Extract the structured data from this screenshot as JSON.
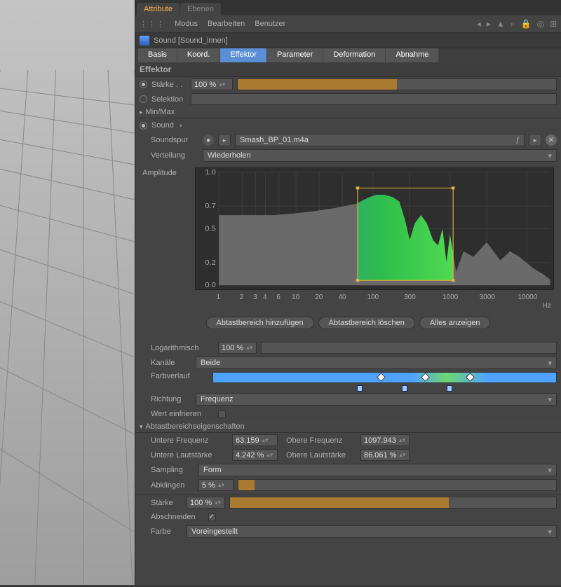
{
  "tabs": {
    "attribute": "Attribute",
    "layers": "Ebenen"
  },
  "toolbar": {
    "mode": "Modus",
    "edit": "Bearbeiten",
    "user": "Benutzer"
  },
  "object": {
    "title": "Sound [Sound_innen]"
  },
  "subtabs": {
    "basis": "Basis",
    "koord": "Koord.",
    "effektor": "Effektor",
    "parameter": "Parameter",
    "deformation": "Deformation",
    "abnahme": "Abnahme"
  },
  "section": {
    "effektor": "Effektor"
  },
  "strength": {
    "label": "Stärke . .",
    "value": "100 %"
  },
  "selection": {
    "label": "Selektion"
  },
  "minmax": {
    "label": "Min/Max"
  },
  "sound": {
    "header": "Sound",
    "track_label": "Soundspur",
    "file": "Smash_BP_01.m4a",
    "distribution_label": "Verteilung",
    "distribution_value": "Wiederholen",
    "amplitude_label": "Amplitude"
  },
  "chart_data": {
    "type": "area",
    "xlabel": "Hz",
    "ylabel": "Amplitude",
    "yticks": [
      0.0,
      0.2,
      0.5,
      0.7,
      1.0
    ],
    "xticks": [
      1,
      2,
      3,
      4,
      6,
      10,
      20,
      40,
      100,
      300,
      1000,
      3000,
      10000
    ],
    "xscale": "log",
    "ylim": [
      0.0,
      1.0
    ],
    "xlim": [
      1,
      20000
    ],
    "selection_box": {
      "xmin": 63.159,
      "xmax": 1097.943,
      "ymin": 0.04242,
      "ymax": 0.86061
    },
    "spectrum": [
      {
        "x": 1,
        "y": 0.62
      },
      {
        "x": 2,
        "y": 0.62
      },
      {
        "x": 3,
        "y": 0.62
      },
      {
        "x": 5,
        "y": 0.62
      },
      {
        "x": 8,
        "y": 0.63
      },
      {
        "x": 15,
        "y": 0.65
      },
      {
        "x": 30,
        "y": 0.68
      },
      {
        "x": 60,
        "y": 0.72
      },
      {
        "x": 90,
        "y": 0.78
      },
      {
        "x": 110,
        "y": 0.8
      },
      {
        "x": 140,
        "y": 0.8
      },
      {
        "x": 180,
        "y": 0.78
      },
      {
        "x": 220,
        "y": 0.74
      },
      {
        "x": 260,
        "y": 0.58
      },
      {
        "x": 300,
        "y": 0.4
      },
      {
        "x": 350,
        "y": 0.55
      },
      {
        "x": 420,
        "y": 0.62
      },
      {
        "x": 500,
        "y": 0.55
      },
      {
        "x": 600,
        "y": 0.4
      },
      {
        "x": 700,
        "y": 0.35
      },
      {
        "x": 800,
        "y": 0.5
      },
      {
        "x": 900,
        "y": 0.2
      },
      {
        "x": 1000,
        "y": 0.45
      },
      {
        "x": 1200,
        "y": 0.12
      },
      {
        "x": 1500,
        "y": 0.3
      },
      {
        "x": 2000,
        "y": 0.25
      },
      {
        "x": 3000,
        "y": 0.38
      },
      {
        "x": 4500,
        "y": 0.22
      },
      {
        "x": 6000,
        "y": 0.3
      },
      {
        "x": 8000,
        "y": 0.25
      },
      {
        "x": 12000,
        "y": 0.15
      },
      {
        "x": 16000,
        "y": 0.1
      },
      {
        "x": 20000,
        "y": 0.05
      }
    ]
  },
  "buttons": {
    "add_range": "Abtastbereich hinzufügen",
    "del_range": "Abtastbereich löschen",
    "show_all": "Alles anzeigen"
  },
  "log": {
    "label": "Logarithmisch",
    "value": "100 %"
  },
  "channels": {
    "label": "Kanäle",
    "value": "Beide"
  },
  "gradient": {
    "label": "Farbverlauf"
  },
  "direction": {
    "label": "Richtung",
    "value": "Frequenz"
  },
  "freeze": {
    "label": "Wert einfrieren"
  },
  "sampling_section": {
    "label": "Abtastbereichseigenschaften"
  },
  "lower_freq": {
    "label": "Untere Frequenz",
    "value": "63.159"
  },
  "upper_freq": {
    "label": "Obere Frequenz",
    "value": "1097.943"
  },
  "lower_vol": {
    "label": "Untere Lautstärke",
    "value": "4.242 %"
  },
  "upper_vol": {
    "label": "Obere Lautstärke",
    "value": "86.061 %"
  },
  "sampling": {
    "label": "Sampling",
    "value": "Form"
  },
  "decay": {
    "label": "Abklingen",
    "value": "5 %"
  },
  "strength2": {
    "label": "Stärke",
    "value": "100 %"
  },
  "clip": {
    "label": "Abschneiden"
  },
  "color": {
    "label": "Farbe",
    "value": "Voreingestellt"
  }
}
